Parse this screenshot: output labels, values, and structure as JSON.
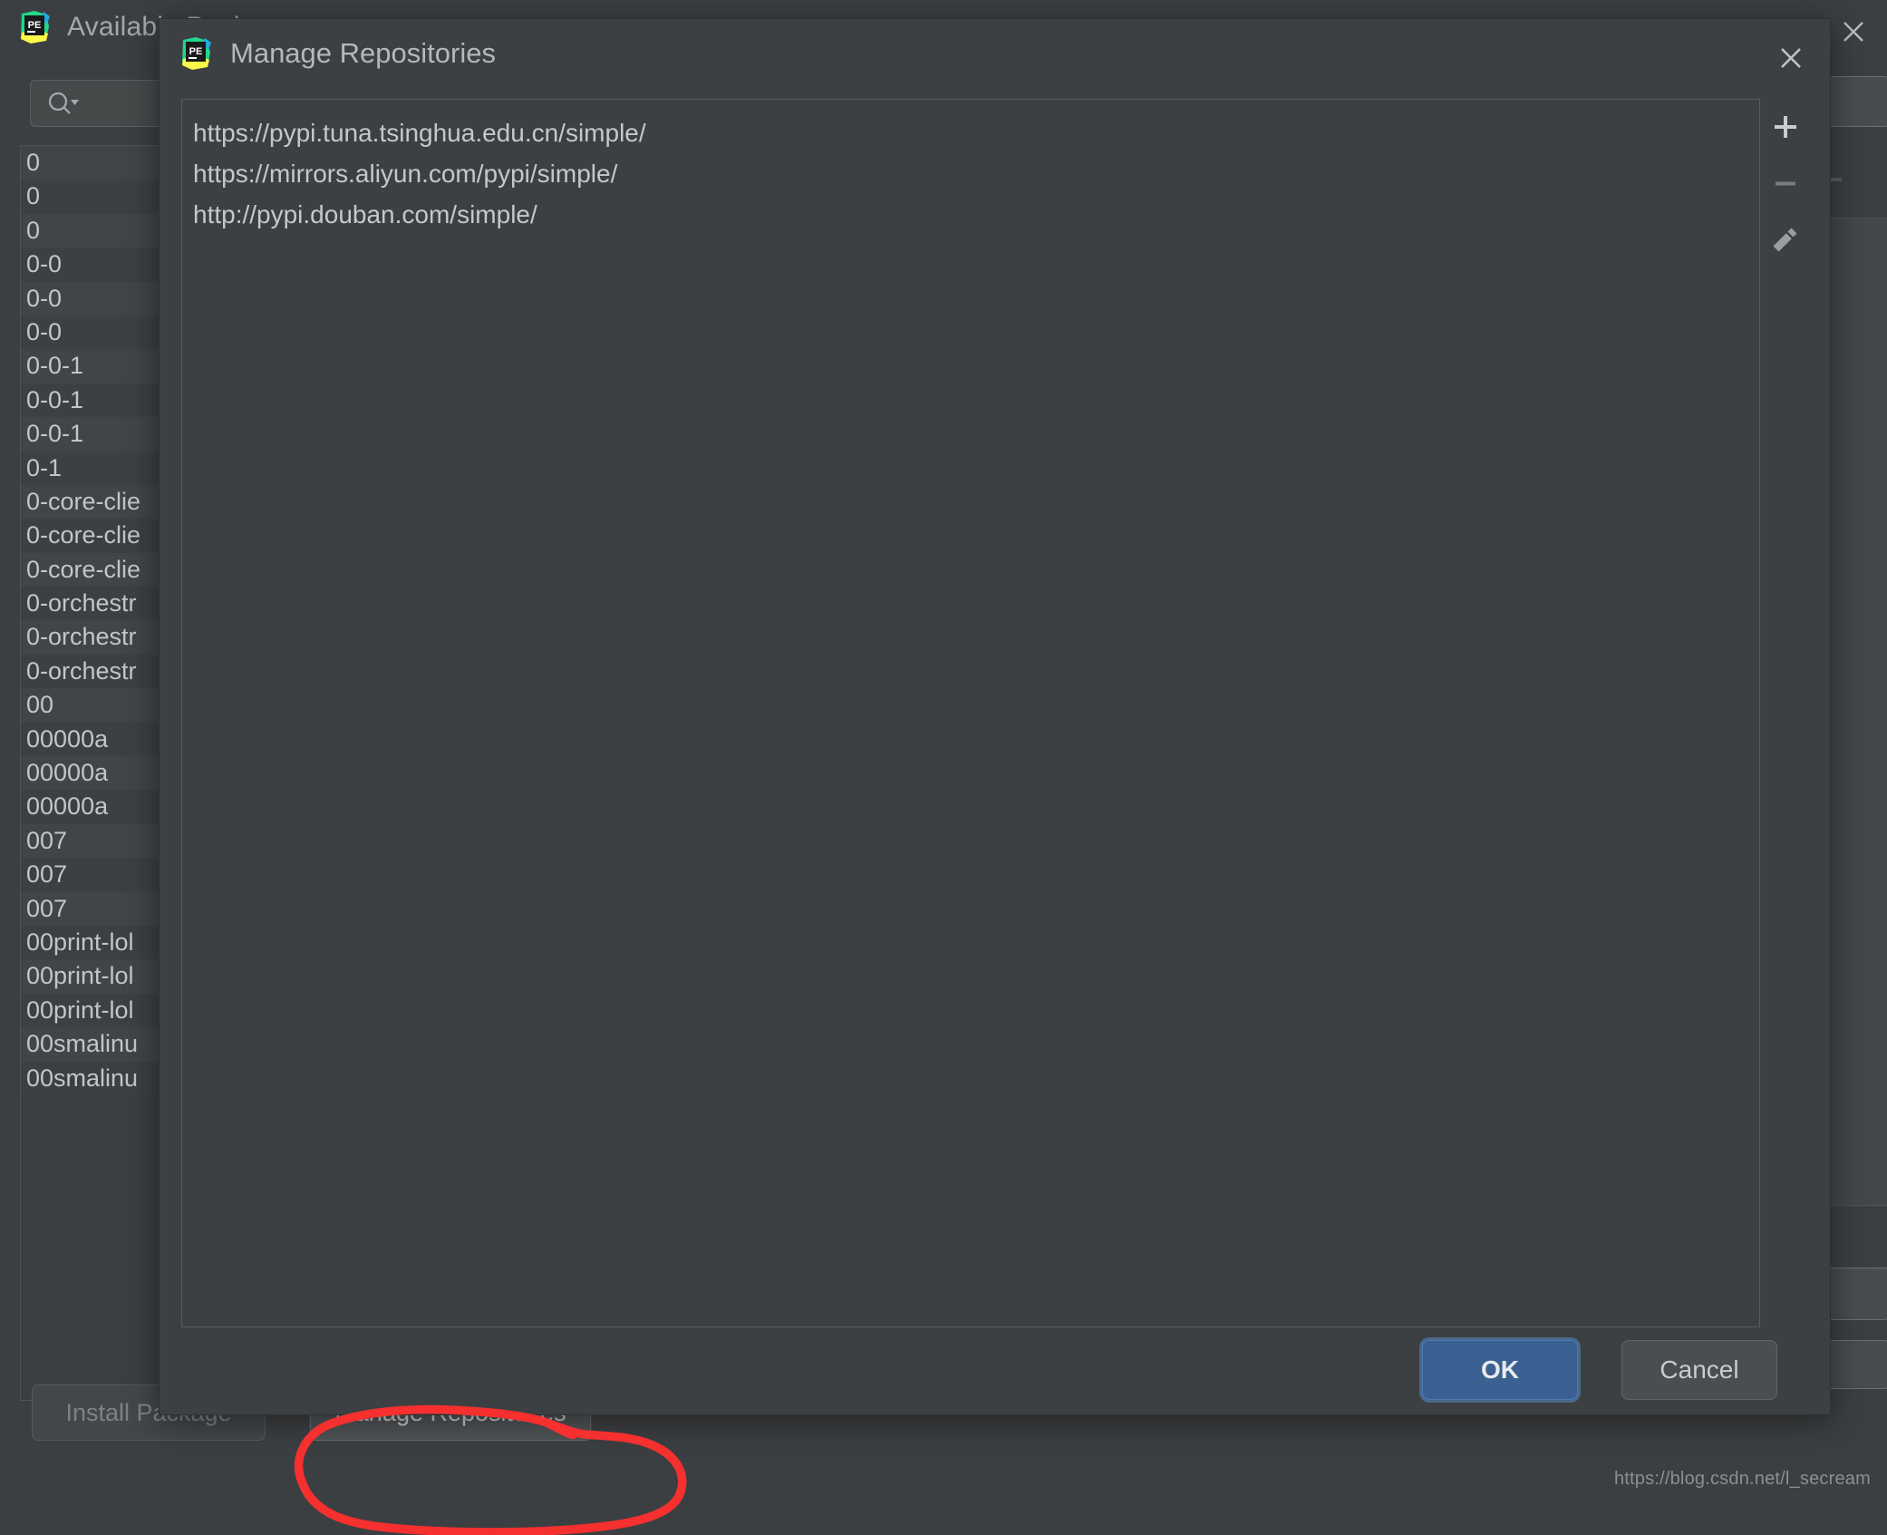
{
  "background_window": {
    "title": "Available Packages",
    "icon": "pycharm-edu-icon",
    "close_icon": "close-icon",
    "search": {
      "value": "",
      "placeholder": "",
      "icon": "search-icon"
    },
    "package_list": [
      "0",
      "0",
      "0",
      "0-0",
      "0-0",
      "0-0",
      "0-0-1",
      "0-0-1",
      "0-0-1",
      "0-1",
      "0-core-clie",
      "0-core-clie",
      "0-core-clie",
      "0-orchestr",
      "0-orchestr",
      "0-orchestr",
      "00",
      "00000a",
      "00000a",
      "00000a",
      "007",
      "007",
      "007",
      "00print-lol",
      "00print-lol",
      "00print-lol",
      "00smalinu",
      "00smalinu"
    ],
    "buttons": {
      "install_package": "Install Package",
      "install_package_enabled": false,
      "manage_repositories": "Manage Repositories",
      "manage_repositories_enabled": true
    }
  },
  "dialog": {
    "title": "Manage Repositories",
    "icon": "pycharm-edu-icon",
    "close_icon": "close-icon",
    "repositories": [
      "https://pypi.tuna.tsinghua.edu.cn/simple/",
      "https://mirrors.aliyun.com/pypi/simple/",
      "http://pypi.douban.com/simple/"
    ],
    "toolbar": [
      {
        "name": "add-repository-button",
        "icon": "plus-icon",
        "enabled": true
      },
      {
        "name": "remove-repository-button",
        "icon": "minus-icon",
        "enabled": false
      },
      {
        "name": "edit-repository-button",
        "icon": "pencil-icon",
        "enabled": true
      }
    ],
    "footer": {
      "ok_label": "OK",
      "cancel_label": "Cancel"
    }
  },
  "annotation": {
    "type": "hand-drawn-oval",
    "color": "#f62f2f",
    "target": "Manage Repositories"
  },
  "watermark": {
    "text": "https://blog.csdn.net/l_secream"
  },
  "colors": {
    "window_bg": "#3c3f41",
    "dialog_bg": "#3c4042",
    "accent_blue": "#3a6192",
    "text_primary": "#c5c8ca",
    "text_dim": "#7e8284",
    "annotation_red": "#f62f2f"
  }
}
